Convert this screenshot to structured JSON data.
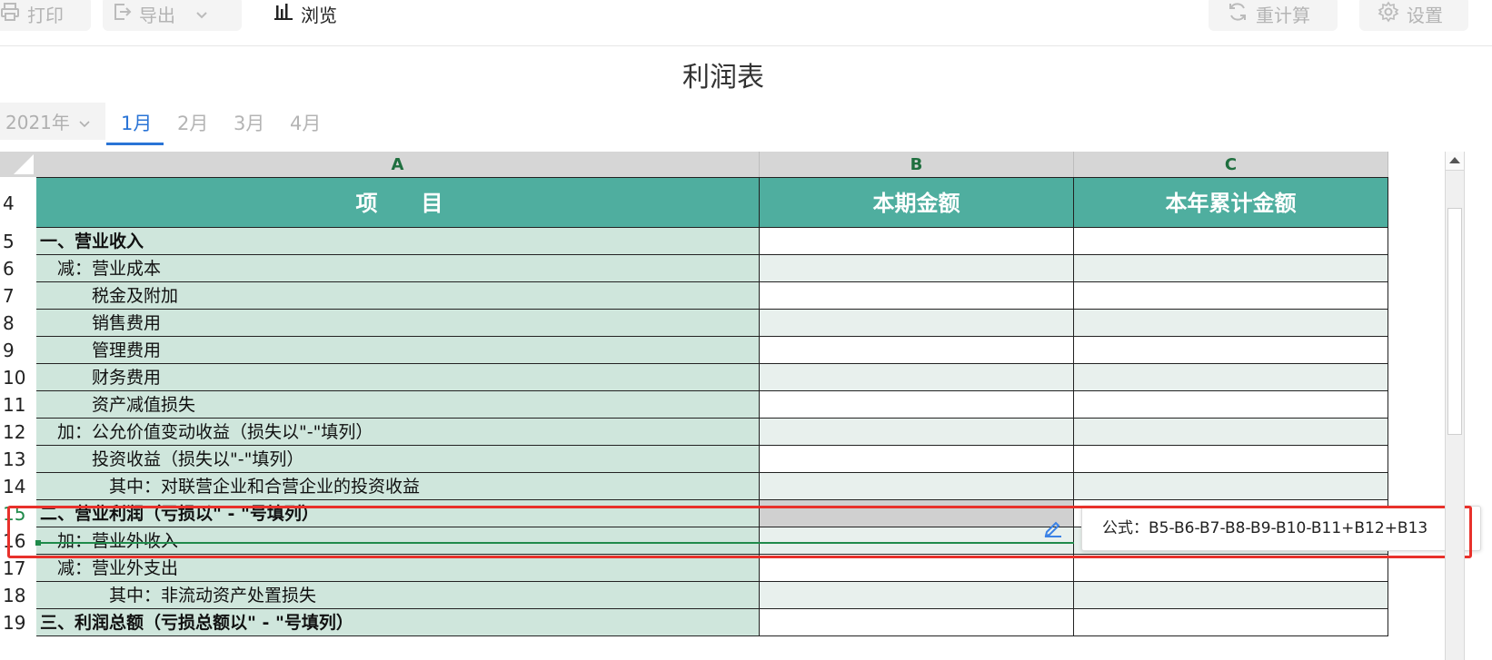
{
  "toolbar": {
    "print_label": "打印",
    "export_label": "导出",
    "browse_label": "浏览",
    "recalc_label": "重计算",
    "settings_label": "设置"
  },
  "title": "利润表",
  "period": {
    "year": "2021年",
    "months": [
      "1月",
      "2月",
      "3月",
      "4月"
    ],
    "active_month": "1月"
  },
  "sheet": {
    "columns": [
      "A",
      "B",
      "C"
    ],
    "header_row": {
      "num": "4",
      "a": "项　　目",
      "b": "本期金额",
      "c": "本年累计金额"
    },
    "rows": [
      {
        "num": "5",
        "text": "一、营业收入"
      },
      {
        "num": "6",
        "text": "　减：营业成本"
      },
      {
        "num": "7",
        "text": "　　　税金及附加"
      },
      {
        "num": "8",
        "text": "　　　销售费用"
      },
      {
        "num": "9",
        "text": "　　　管理费用"
      },
      {
        "num": "10",
        "text": "　　　财务费用"
      },
      {
        "num": "11",
        "text": "　　　资产减值损失"
      },
      {
        "num": "12",
        "text": "　加：公允价值变动收益（损失以\"-\"填列）"
      },
      {
        "num": "13",
        "text": "　　　投资收益（损失以\"-\"填列）"
      },
      {
        "num": "14",
        "text": "　　　　其中：对联营企业和合营企业的投资收益"
      },
      {
        "num": "15",
        "text": "二、营业利润（亏损以\" - \"号填列）"
      },
      {
        "num": "16",
        "text": "　加：营业外收入"
      },
      {
        "num": "17",
        "text": "　减：营业外支出"
      },
      {
        "num": "18",
        "text": "　　　　其中：非流动资产处置损失"
      },
      {
        "num": "19",
        "text": "三、利润总额（亏损总额以\" - \"号填列）"
      }
    ]
  },
  "formula_tooltip": "公式：B5-B6-B7-B8-B9-B10-B11+B12+B13",
  "colors": {
    "header_fill": "#4fae9f",
    "column_a_fill": "#cfe6dc",
    "accent_blue": "#2a74d6",
    "highlight_red": "#e8312b"
  }
}
